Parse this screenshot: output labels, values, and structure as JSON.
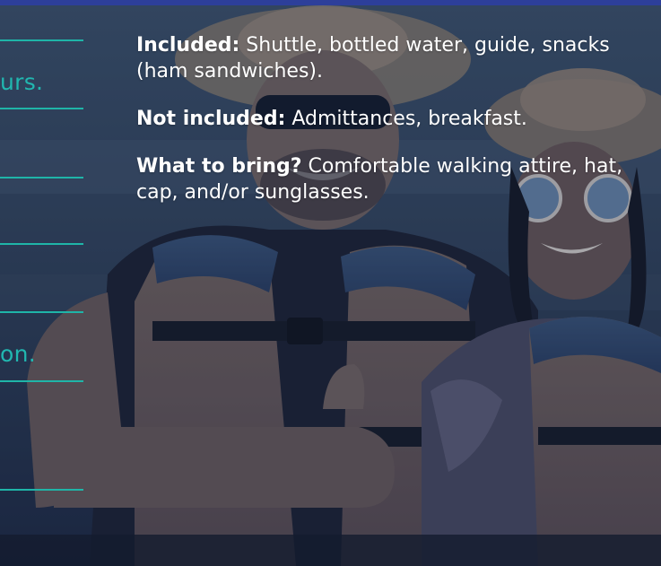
{
  "left_list": {
    "fragments": [
      "urs.",
      "on."
    ]
  },
  "info": {
    "included": {
      "label": "Included:",
      "text": " Shuttle, bottled water, guide, snacks (ham sandwiches)."
    },
    "not_included": {
      "label": "Not included:",
      "text": " Admittances, breakfast."
    },
    "what_to_bring": {
      "label": "What to bring?",
      "text": " Comfortable walking attire, hat, cap, and/or sunglasses."
    }
  },
  "colors": {
    "accent_teal": "#1fb5a8",
    "top_bar": "#2d3f9a",
    "overlay": "#23314d"
  }
}
